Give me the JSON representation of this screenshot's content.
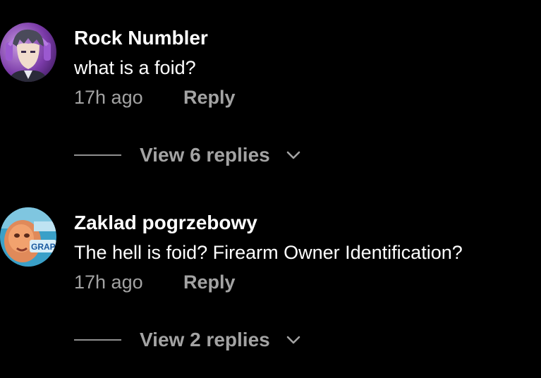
{
  "comments": [
    {
      "author": "Rock Numbler",
      "text": "what is a foid?",
      "time": "17h ago",
      "reply_label": "Reply",
      "view_replies": "View 6 replies",
      "avatar_icon": "anime-character-avatar"
    },
    {
      "author": "Zaklad pogrzebowy",
      "text": "The hell is foid? Firearm Owner Identification?",
      "time": "17h ago",
      "reply_label": "Reply",
      "view_replies": "View 2 replies",
      "avatar_icon": "photo-avatar"
    }
  ],
  "colors": {
    "background": "#000000",
    "primary_text": "#ffffff",
    "secondary_text": "#a3a3a3"
  },
  "icons": {
    "expand": "chevron-down-icon"
  }
}
